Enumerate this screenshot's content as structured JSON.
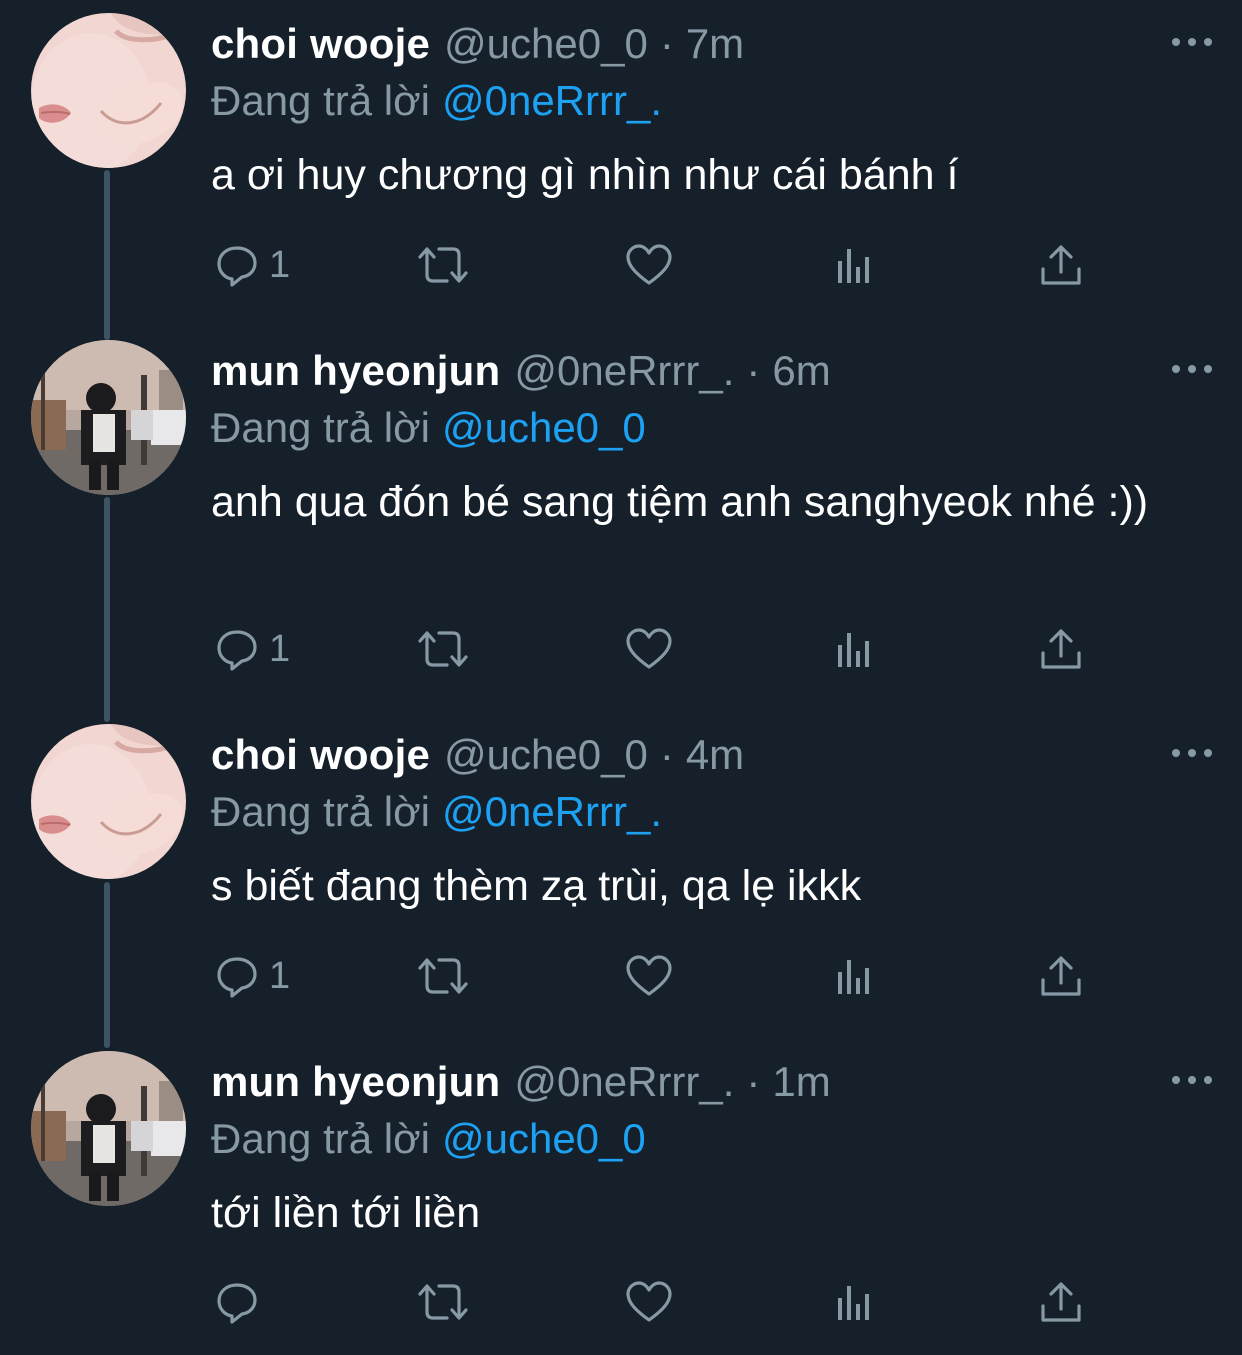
{
  "colors": {
    "background": "#15202b",
    "secondary_text": "#8899a6",
    "mention": "#1da1f2",
    "thread_line": "#3d5466"
  },
  "tweets": [
    {
      "display_name": "choi wooje",
      "handle": "@uche0_0",
      "separator": "·",
      "time": "7m",
      "reply_prefix": "Đang trả lời",
      "reply_to": "@0neRrrr_.",
      "text": "a ơi huy chương gì nhìn như cái bánh í",
      "reply_count": "1",
      "avatar_icon": "avatar-photo-icon"
    },
    {
      "display_name": "mun hyeonjun",
      "handle": "@0neRrrr_.",
      "separator": "·",
      "time": "6m",
      "reply_prefix": "Đang trả lời",
      "reply_to": "@uche0_0",
      "text": "anh qua đón bé sang tiệm anh sanghyeok nhé :))",
      "reply_count": "1",
      "avatar_icon": "avatar-photo-icon"
    },
    {
      "display_name": "choi wooje",
      "handle": "@uche0_0",
      "separator": "·",
      "time": "4m",
      "reply_prefix": "Đang trả lời",
      "reply_to": "@0neRrrr_.",
      "text": "s biết đang thèm zạ trùi, qa lẹ ikkk",
      "reply_count": "1",
      "avatar_icon": "avatar-photo-icon"
    },
    {
      "display_name": "mun hyeonjun",
      "handle": "@0neRrrr_.",
      "separator": "·",
      "time": "1m",
      "reply_prefix": "Đang trả lời",
      "reply_to": "@uche0_0",
      "text": "tới liền tới liền",
      "reply_count": "",
      "avatar_icon": "avatar-photo-icon"
    }
  ],
  "action_icons": [
    "reply-icon",
    "retweet-icon",
    "like-icon",
    "analytics-icon",
    "share-icon"
  ]
}
